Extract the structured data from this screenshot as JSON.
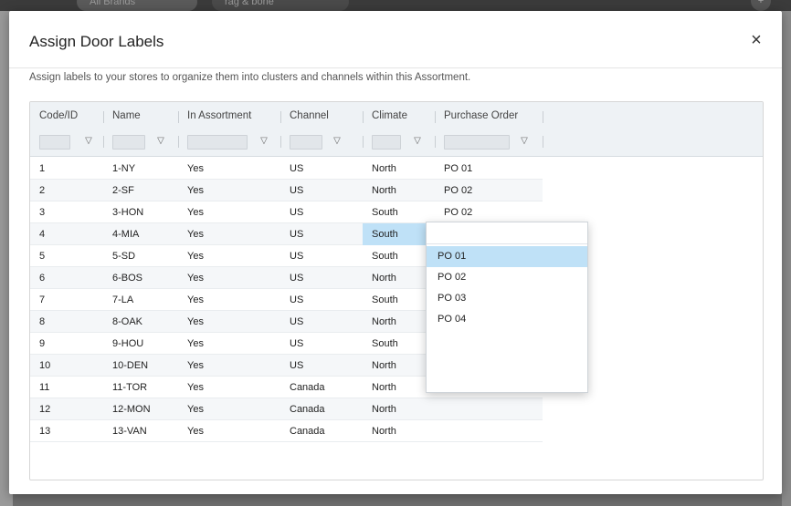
{
  "background": {
    "tabs": [
      "All Brands",
      "rag & bone"
    ],
    "avatar": "+"
  },
  "modal": {
    "title": "Assign Door Labels",
    "close": "×",
    "description": "Assign labels to your stores to organize them into clusters and channels within this Assortment."
  },
  "grid": {
    "columns": [
      "Code/ID",
      "Name",
      "In Assortment",
      "Channel",
      "Climate",
      "Purchase Order"
    ],
    "filter_icon": "▽",
    "rows": [
      [
        "1",
        "1-NY",
        "Yes",
        "US",
        "North",
        "PO 01"
      ],
      [
        "2",
        "2-SF",
        "Yes",
        "US",
        "North",
        "PO 02"
      ],
      [
        "3",
        "3-HON",
        "Yes",
        "US",
        "South",
        "PO 02"
      ],
      [
        "4",
        "4-MIA",
        "Yes",
        "US",
        "South",
        ""
      ],
      [
        "5",
        "5-SD",
        "Yes",
        "US",
        "South",
        ""
      ],
      [
        "6",
        "6-BOS",
        "Yes",
        "US",
        "North",
        ""
      ],
      [
        "7",
        "7-LA",
        "Yes",
        "US",
        "South",
        ""
      ],
      [
        "8",
        "8-OAK",
        "Yes",
        "US",
        "North",
        ""
      ],
      [
        "9",
        "9-HOU",
        "Yes",
        "US",
        "South",
        ""
      ],
      [
        "10",
        "10-DEN",
        "Yes",
        "US",
        "North",
        ""
      ],
      [
        "11",
        "11-TOR",
        "Yes",
        "Canada",
        "North",
        ""
      ],
      [
        "12",
        "12-MON",
        "Yes",
        "Canada",
        "North",
        ""
      ],
      [
        "13",
        "13-VAN",
        "Yes",
        "Canada",
        "North",
        ""
      ]
    ],
    "selected": {
      "row": 3,
      "col": 4
    }
  },
  "dropdown": {
    "options": [
      "PO 01",
      "PO 02",
      "PO 03",
      "PO 04"
    ],
    "active_index": 0
  },
  "colors": {
    "selection": "#bfe1f7",
    "header_bg": "#eef2f5"
  }
}
